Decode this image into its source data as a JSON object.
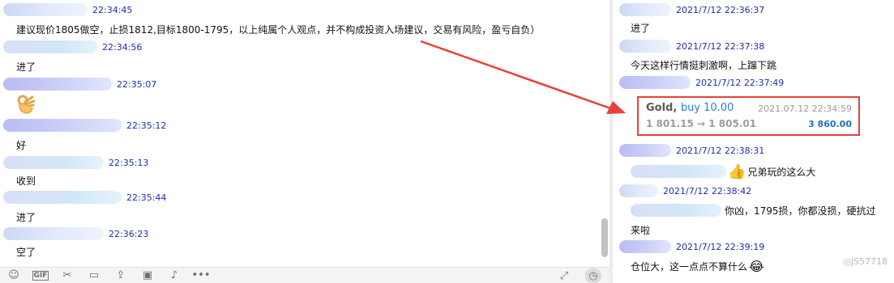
{
  "left_chat": {
    "messages": [
      {
        "time": "22:34:45",
        "text": "建议现价1805做空，止损1812,目标1800-1795，以上纯属个人观点，并不构成投资入场建议，交易有风险，盈亏自负）"
      },
      {
        "time": "22:34:56",
        "text": "进了"
      },
      {
        "time": "22:35:07",
        "text": ""
      },
      {
        "time": "22:35:12",
        "text": "好"
      },
      {
        "time": "22:35:13",
        "text": "收到"
      },
      {
        "time": "22:35:44",
        "text": "进了"
      },
      {
        "time": "22:36:23",
        "text": "空了"
      }
    ],
    "ok_emoji_icon": "ok-hand-icon"
  },
  "right_chat": {
    "messages": [
      {
        "time": "2021/7/12 22:36:37",
        "text": "进了"
      },
      {
        "time": "2021/7/12 22:37:38",
        "text": "今天这样行情挺刺激啊，上蹿下跳"
      },
      {
        "time": "2021/7/12 22:37:49",
        "text": ""
      },
      {
        "time": "2021/7/12 22:38:31",
        "text": "兄弟玩的这么大"
      },
      {
        "time": "2021/7/12 22:38:42",
        "text": "你凶，1795损，你都没损，硬抗过"
      },
      {
        "time": "",
        "text": "来啦"
      },
      {
        "time": "2021/7/12 22:39:19",
        "text": "仓位大，这一点点不算什么"
      }
    ]
  },
  "trade_card": {
    "symbol": "Gold,",
    "action": "buy 10.00",
    "datetime": "2021.07.12 22:34:59",
    "prices": "1 801.15 → 1 805.01",
    "profit": "3 860.00"
  },
  "watermark": "◎JS57718",
  "colors": {
    "timestamp": "#1f2db0",
    "highlight_border": "#e8403a",
    "action_blue": "#2a7fd1",
    "profit_blue": "#1e73c8",
    "arrow_red": "#e8403a"
  }
}
